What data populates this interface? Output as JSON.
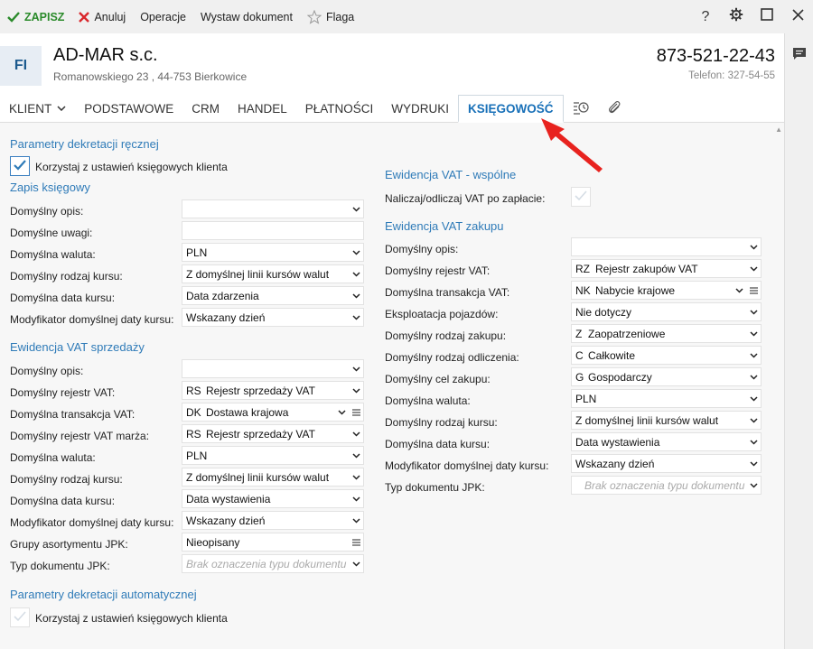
{
  "toolbar": {
    "save": "ZAPISZ",
    "cancel": "Anuluj",
    "operations": "Operacje",
    "issue": "Wystaw dokument",
    "flag": "Flaga",
    "help": "?"
  },
  "header": {
    "initials": "FI",
    "name": "AD-MAR s.c.",
    "address": "Romanowskiego 23 , 44-753 Bierkowice",
    "phone": "873-521-22-43",
    "phone2": "Telefon: 327-54-55"
  },
  "tabs": [
    "KLIENT",
    "PODSTAWOWE",
    "CRM",
    "HANDEL",
    "PŁATNOŚCI",
    "WYDRUKI",
    "KSIĘGOWOŚĆ"
  ],
  "left": {
    "manual_title": "Parametry dekretacji ręcznej",
    "manual_checkbox": "Korzystaj z ustawień księgowych klienta",
    "journal_title": "Zapis księgowy",
    "journal": [
      {
        "label": "Domyślny opis:",
        "value": ""
      },
      {
        "label": "Domyślne uwagi:",
        "value": ""
      },
      {
        "label": "Domyślna waluta:",
        "value": "PLN"
      },
      {
        "label": "Domyślny rodzaj kursu:",
        "value": "Z domyślnej linii kursów walut"
      },
      {
        "label": "Domyślna data kursu:",
        "value": "Data zdarzenia"
      },
      {
        "label": "Modyfikator domyślnej daty kursu:",
        "value": "Wskazany dzień"
      }
    ],
    "sales_title": "Ewidencja VAT sprzedaży",
    "sales": [
      {
        "label": "Domyślny opis:",
        "code": "",
        "value": ""
      },
      {
        "label": "Domyślny rejestr VAT:",
        "code": "RS",
        "value": "Rejestr sprzedaży VAT"
      },
      {
        "label": "Domyślna transakcja VAT:",
        "code": "DK",
        "value": "Dostawa krajowa"
      },
      {
        "label": "Domyślny rejestr VAT marża:",
        "code": "RS",
        "value": "Rejestr sprzedaży VAT"
      },
      {
        "label": "Domyślna waluta:",
        "code": "",
        "value": "PLN"
      },
      {
        "label": "Domyślny rodzaj kursu:",
        "code": "",
        "value": "Z domyślnej linii kursów walut"
      },
      {
        "label": "Domyślna data kursu:",
        "code": "",
        "value": "Data wystawienia"
      },
      {
        "label": "Modyfikator domyślnej daty kursu:",
        "code": "",
        "value": "Wskazany dzień"
      },
      {
        "label": "Grupy asortymentu JPK:",
        "code": "",
        "value": "Nieopisany"
      },
      {
        "label": "Typ dokumentu JPK:",
        "code": "",
        "value": ""
      }
    ],
    "jpk_placeholder": "Brak oznaczenia typu dokumentu",
    "auto_title": "Parametry dekretacji automatycznej",
    "auto_checkbox": "Korzystaj z ustawień księgowych klienta"
  },
  "right": {
    "common_title": "Ewidencja VAT - wspólne",
    "common_label": "Naliczaj/odliczaj VAT po zapłacie:",
    "purchase_title": "Ewidencja VAT zakupu",
    "purchase": [
      {
        "label": "Domyślny opis:",
        "code": "",
        "value": ""
      },
      {
        "label": "Domyślny rejestr VAT:",
        "code": "RZ",
        "value": "Rejestr zakupów VAT"
      },
      {
        "label": "Domyślna transakcja VAT:",
        "code": "NK",
        "value": "Nabycie krajowe"
      },
      {
        "label": "Eksploatacja pojazdów:",
        "code": "",
        "value": "Nie dotyczy"
      },
      {
        "label": "Domyślny rodzaj zakupu:",
        "code": "Z",
        "value": "Zaopatrzeniowe"
      },
      {
        "label": "Domyślny rodzaj odliczenia:",
        "code": "C",
        "value": "Całkowite"
      },
      {
        "label": "Domyślny cel zakupu:",
        "code": "G",
        "value": "Gospodarczy"
      },
      {
        "label": "Domyślna waluta:",
        "code": "",
        "value": "PLN"
      },
      {
        "label": "Domyślny rodzaj kursu:",
        "code": "",
        "value": "Z domyślnej linii kursów walut"
      },
      {
        "label": "Domyślna data kursu:",
        "code": "",
        "value": "Data wystawienia"
      },
      {
        "label": "Modyfikator domyślnej daty kursu:",
        "code": "",
        "value": "Wskazany dzień"
      },
      {
        "label": "Typ dokumentu JPK:",
        "code": "",
        "value": ""
      }
    ],
    "jpk_placeholder": "Brak oznaczenia typu dokumentu"
  },
  "colors": {
    "accent": "#1870b8",
    "save": "#2a8a2a",
    "cancel": "#d9262b",
    "arrow": "#e8231f"
  }
}
